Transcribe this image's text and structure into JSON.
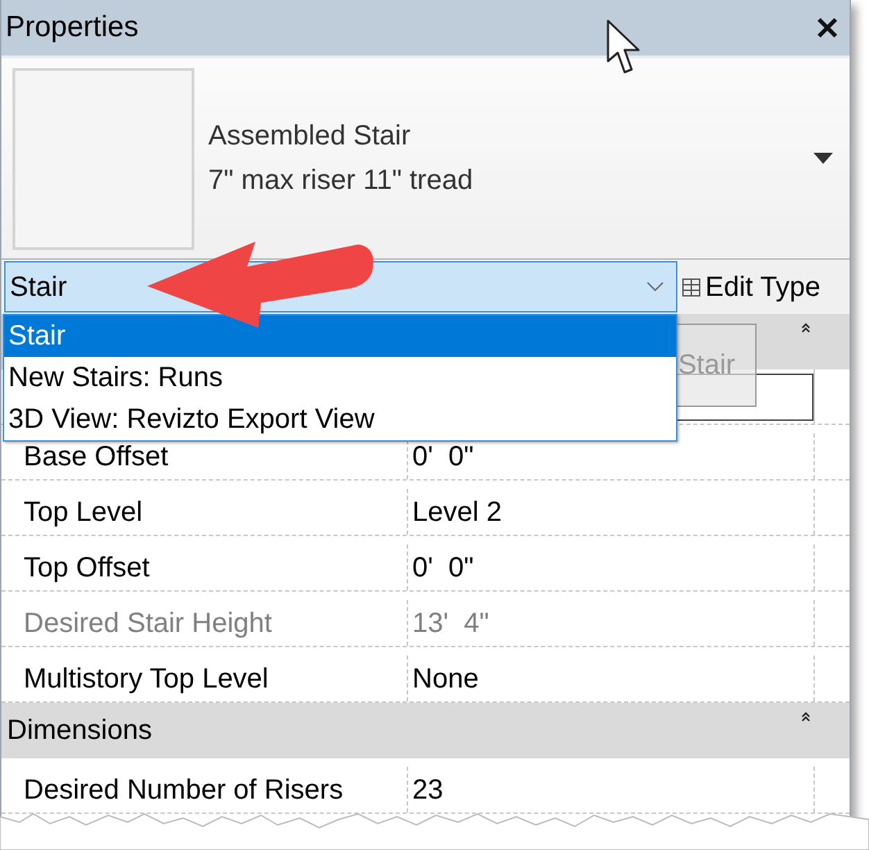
{
  "panel": {
    "title": "Properties"
  },
  "type_selector": {
    "name": "Assembled Stair",
    "subtitle": "7\" max riser 11\" tread"
  },
  "filter": {
    "value": "Stair",
    "expanded": true,
    "options": [
      {
        "label": "Stair",
        "selected": true
      },
      {
        "label": "New Stairs: Runs",
        "selected": false
      },
      {
        "label": "3D View: Revizto Export View",
        "selected": false
      }
    ]
  },
  "edit_type_button": "Edit Type",
  "drag_tooltip": "Stair",
  "rows": [
    {
      "kind": "header"
    },
    {
      "kind": "input"
    },
    {
      "kind": "property",
      "label": "Base Offset",
      "value": "0'  0\"",
      "disabled": false
    },
    {
      "kind": "property",
      "label": "Top Level",
      "value": "Level 2",
      "disabled": false
    },
    {
      "kind": "property",
      "label": "Top Offset",
      "value": "0'  0\"",
      "disabled": false
    },
    {
      "kind": "property",
      "label": "Desired Stair Height",
      "value": "13'  4\"",
      "disabled": true
    },
    {
      "kind": "property",
      "label": "Multistory Top Level",
      "value": "None",
      "disabled": false
    },
    {
      "kind": "header",
      "label": "Dimensions"
    },
    {
      "kind": "property",
      "label": "Desired Number of Risers",
      "value": "23",
      "disabled": false
    }
  ]
}
